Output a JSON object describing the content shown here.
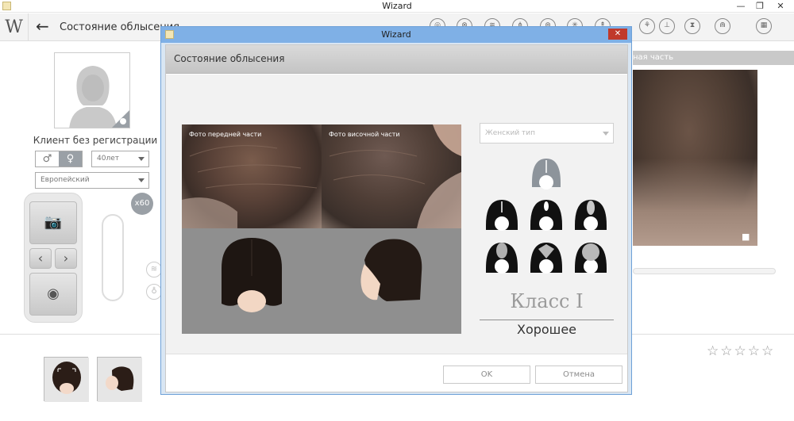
{
  "window": {
    "title": "Wizard",
    "minimize": "—",
    "restore": "❐",
    "close": "✕"
  },
  "header": {
    "logo": "W",
    "page_title": "Состояние облысения",
    "tools": [
      "◎",
      "⊗",
      "≋",
      "⋔",
      "⊛",
      "✳",
      "↟",
      "⚘",
      "⊥",
      "⧗",
      "⋒",
      "▦"
    ]
  },
  "client": {
    "name": "Клиент без регистрации",
    "gender_male": "♂",
    "gender_female": "♀",
    "age": "40лет",
    "ethnicity": "Европейский"
  },
  "device": {
    "magnification": "x60"
  },
  "background_panel": {
    "header": "ная часть"
  },
  "rating": {
    "stars": "☆☆☆☆☆"
  },
  "dialog": {
    "title": "Wizard",
    "header_title": "Состояние облысения",
    "photo_front_label": "Фото передней части",
    "photo_side_label": "Фото височной части",
    "hair_type": "Женский тип",
    "class_label": "Класс I",
    "quality": "Хорошее",
    "ok_label": "OK",
    "cancel_label": "Отмена"
  },
  "colors": {
    "accent": "#7fb0e6",
    "close": "#c0392b",
    "badge": "#9aa0a6"
  }
}
